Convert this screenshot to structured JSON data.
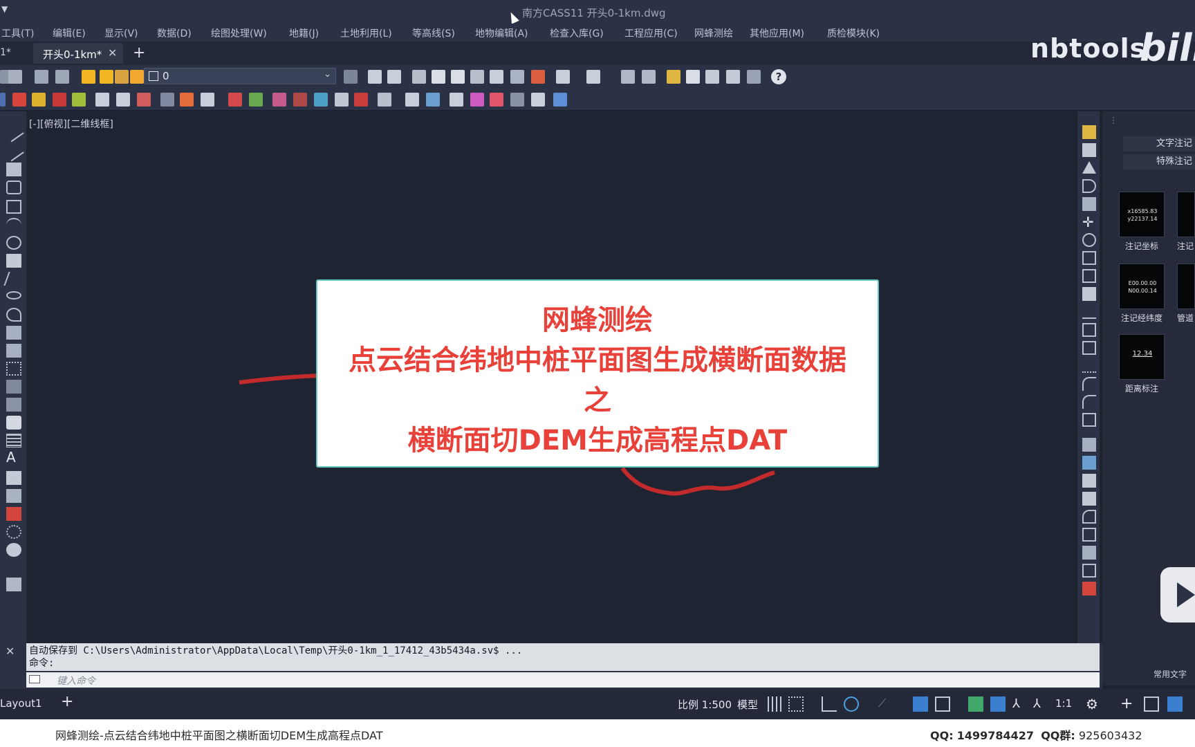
{
  "window": {
    "title": "南方CASS11    开头0-1km.dwg",
    "system_menu_glyph": "▼"
  },
  "menu": [
    "工具(T)",
    "编辑(E)",
    "显示(V)",
    "数据(D)",
    "绘图处理(W)",
    "地籍(J)",
    "土地利用(L)",
    "等高线(S)",
    "地物编辑(A)",
    "检查入库(G)",
    "工程应用(C)",
    "网蜂测绘",
    "其他应用(M)",
    "质检模块(K)"
  ],
  "tabs": {
    "previous_label": "1*",
    "active_label": "开头0-1km*",
    "close_glyph": "✕",
    "add_glyph": "+"
  },
  "brand": {
    "text": "nbtools",
    "logo": "bili"
  },
  "layer_control": {
    "value": "0",
    "chevron": "⌄"
  },
  "help_label": "?",
  "viewport": {
    "label": "[-][俯视][二维线框]"
  },
  "banner": {
    "line1": "网蜂测绘",
    "line2": "点云结合纬地中桩平面图生成横断面数据",
    "line3": "之",
    "line4": "横断面切DEM生成高程点DAT",
    "text_color": "#e8413a",
    "border_color": "#63c9c3"
  },
  "side_panel": {
    "tab1": "文字注记",
    "tab2": "特殊注记",
    "tools": [
      {
        "thumb_line1": "x16585.83",
        "thumb_line2": "y22137.14",
        "label": "注记坐标"
      },
      {
        "thumb_line1": "E00.00.00",
        "thumb_line2": "N00.00.14",
        "label": "注记经纬度"
      },
      {
        "thumb_line1": "12.34",
        "thumb_line2": "",
        "label": "距离标注"
      }
    ],
    "partial_labels": [
      "注记",
      "管道"
    ],
    "footer": "常用文字"
  },
  "command": {
    "history_line1": "自动保存到 C:\\Users\\Administrator\\AppData\\Local\\Temp\\开头0-1km_1_17412_43b5434a.sv$ ...",
    "history_line2": "命令:",
    "input_placeholder": "键入命令",
    "close_glyph": "✕"
  },
  "status": {
    "layout_tab": "Layout1",
    "add_glyph": "+",
    "scale": "比例 1:500",
    "model": "模型",
    "annotation_scale": "1:1"
  },
  "info_bar": {
    "video_title": "网蜂测绘-点云结合纬地中桩平面图之横断面切DEM生成高程点DAT",
    "qq_label": "QQ:",
    "qq_number": "1499784427",
    "qq_group_label": "QQ群:",
    "qq_group_number": "925603432"
  },
  "colors": {
    "ui_dark": "#2b3245",
    "canvas": "#1f2432",
    "polyline": "#d42b2b"
  }
}
